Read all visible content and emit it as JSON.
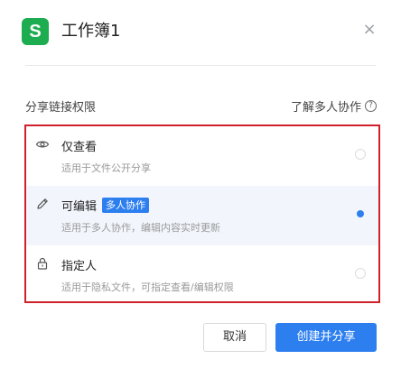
{
  "dialog": {
    "title": "工作簿1",
    "app_icon_letter": "S",
    "close_symbol": "×"
  },
  "share": {
    "section_title": "分享链接权限",
    "learn_more": "了解多人协作",
    "help_symbol": "?",
    "options": [
      {
        "label": "仅查看",
        "desc": "适用于文件公开分享",
        "icon": "eye-icon",
        "selected": false
      },
      {
        "label": "可编辑",
        "badge": "多人协作",
        "desc": "适用于多人协作，编辑内容实时更新",
        "icon": "pencil-icon",
        "selected": true
      },
      {
        "label": "指定人",
        "desc": "适用于隐私文件，可指定查看/编辑权限",
        "icon": "lock-icon",
        "selected": false
      }
    ]
  },
  "footer": {
    "cancel_label": "取消",
    "primary_label": "创建并分享"
  },
  "colors": {
    "accent": "#2d7ff0",
    "app_icon": "#1dac4f",
    "highlight_border": "#d0202a"
  }
}
